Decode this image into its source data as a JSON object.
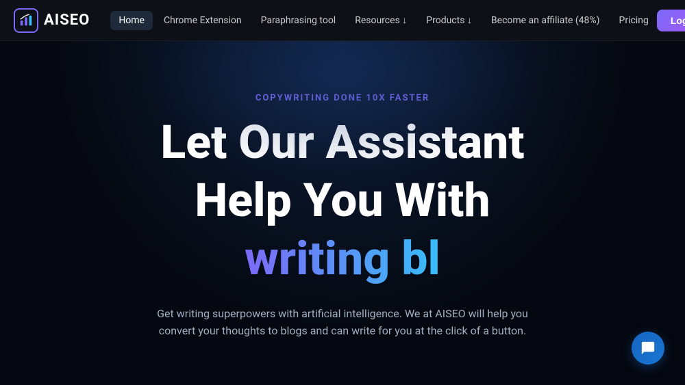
{
  "brand": {
    "name": "AISEO"
  },
  "nav": {
    "links": [
      {
        "id": "home",
        "label": "Home",
        "active": true
      },
      {
        "id": "chrome-extension",
        "label": "Chrome Extension",
        "active": false
      },
      {
        "id": "paraphrasing-tool",
        "label": "Paraphrasing tool",
        "active": false
      },
      {
        "id": "resources",
        "label": "Resources ↓",
        "active": false
      },
      {
        "id": "products",
        "label": "Products ↓",
        "active": false
      },
      {
        "id": "become-affiliate",
        "label": "Become an affiliate (48%)",
        "active": false
      },
      {
        "id": "pricing",
        "label": "Pricing",
        "active": false
      }
    ],
    "login_label": "Login"
  },
  "hero": {
    "subtitle": "COPYWRITING DONE 10X FASTER",
    "headline_line1": "Let Our Assistant",
    "headline_line2": "Help You With",
    "animated_text": "writing bl",
    "description": "Get writing superpowers with artificial intelligence. We at AISEO will help you convert your thoughts to blogs and can write for you at the click of a button."
  }
}
